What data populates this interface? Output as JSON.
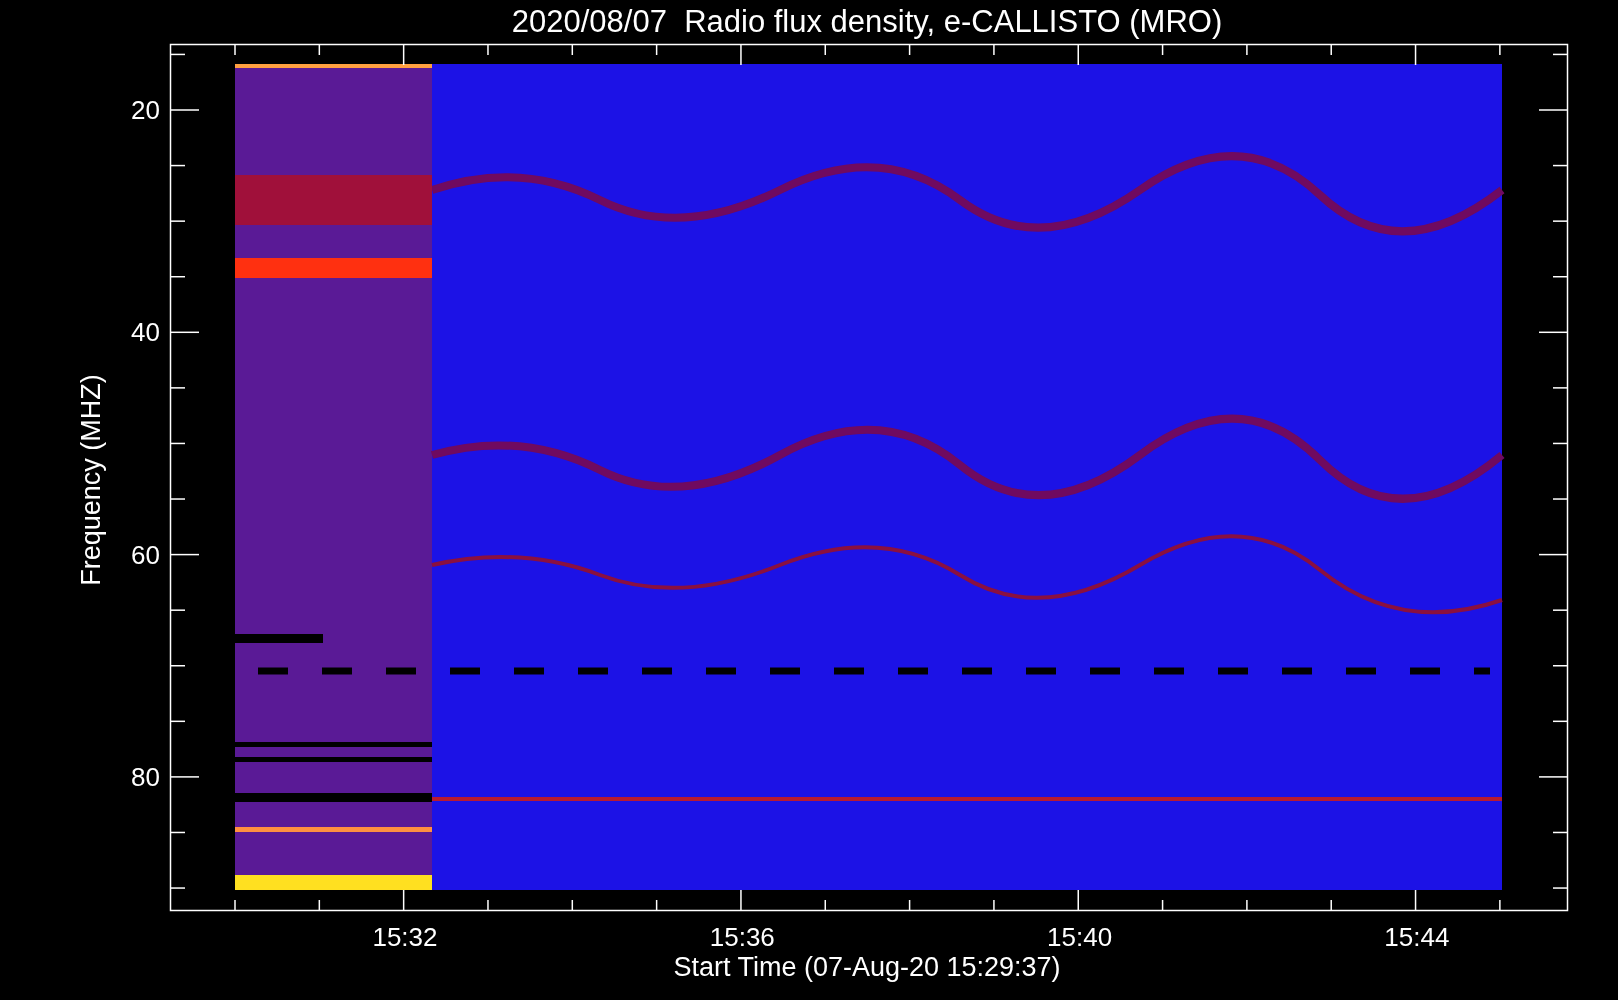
{
  "title": "2020/08/07  Radio flux density, e-CALLISTO (MRO)",
  "y_axis": {
    "label": "Frequency (MHZ)",
    "ticks": [
      "20",
      "40",
      "60",
      "80"
    ]
  },
  "x_axis": {
    "label": "Start Time (07-Aug-20 15:29:37)",
    "ticks": [
      "15:32",
      "15:36",
      "15:40",
      "15:44"
    ]
  }
}
